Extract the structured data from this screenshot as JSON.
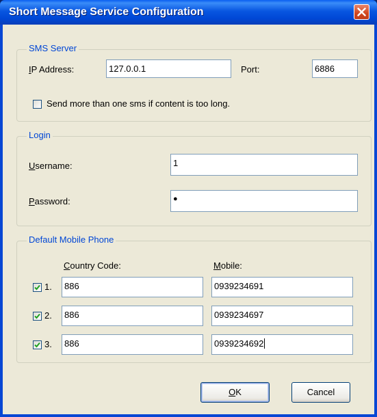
{
  "window": {
    "title": "Short Message Service Configuration"
  },
  "sms_server": {
    "legend": "SMS Server",
    "ip_label_u": "I",
    "ip_label_rest": "P Address:",
    "ip_value": "127.0.0.1",
    "port_label": "Port:",
    "port_value": "6886",
    "multi_sms_label": "Send more than one sms if content is too long.",
    "multi_sms_checked": false
  },
  "login": {
    "legend": "Login",
    "username_label_u": "U",
    "username_label_rest": "sername:",
    "username_value": "1",
    "password_label_u": "P",
    "password_label_rest": "assword:",
    "password_value": "●"
  },
  "default_mobile": {
    "legend": "Default Mobile Phone",
    "country_header_u": "C",
    "country_header_rest": "ountry Code:",
    "mobile_header_u": "M",
    "mobile_header_rest": "obile:",
    "rows": [
      {
        "checked": true,
        "index": "1.",
        "country": "886",
        "mobile": "0939234691"
      },
      {
        "checked": true,
        "index": "2.",
        "country": "886",
        "mobile": "0939234697"
      },
      {
        "checked": true,
        "index": "3.",
        "country": "886",
        "mobile": "0939234692"
      }
    ]
  },
  "buttons": {
    "ok_u": "O",
    "ok_rest": "K",
    "cancel": "Cancel"
  },
  "colors": {
    "title_bar": "#0054e3",
    "dialog_bg": "#ece9d8",
    "group_text": "#0046d5",
    "close_button": "#d1461f"
  }
}
